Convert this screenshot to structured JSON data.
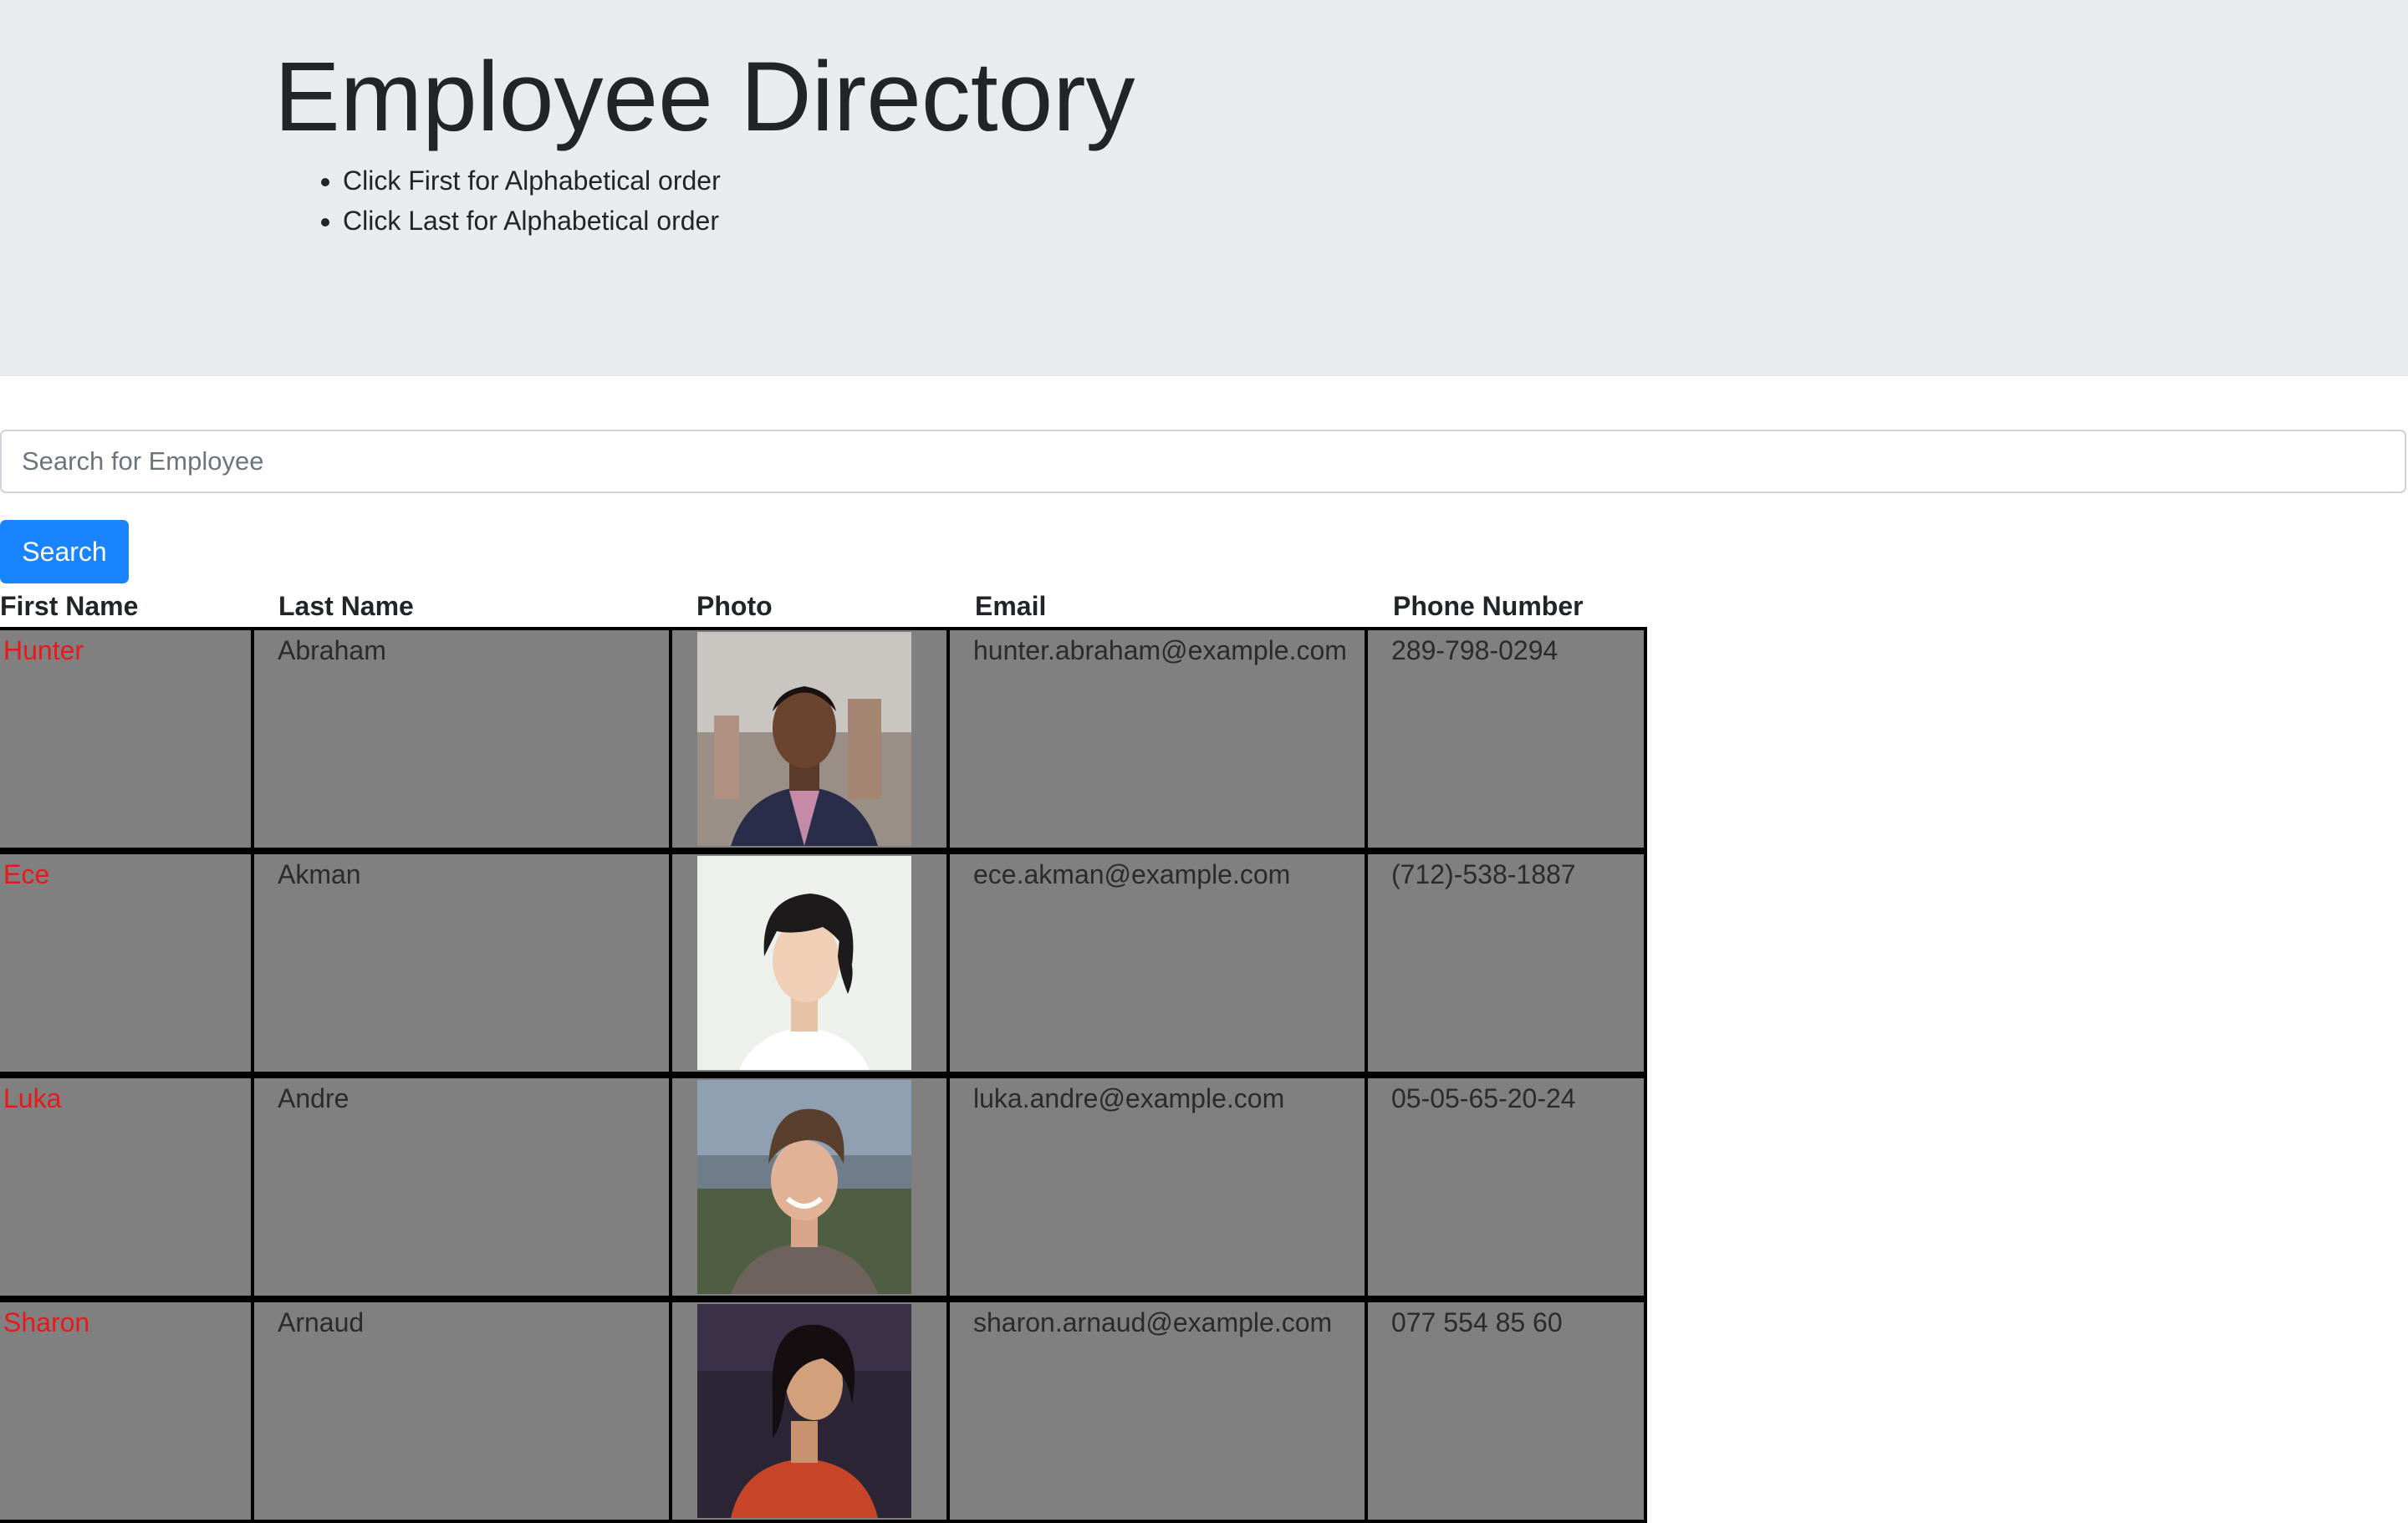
{
  "header": {
    "title": "Employee Directory",
    "hints": [
      "Click First for Alphabetical order",
      "Click Last for Alphabetical order"
    ]
  },
  "search": {
    "placeholder": "Search for Employee",
    "value": "",
    "button_label": "Search",
    "button_color": "#1a84ff"
  },
  "table": {
    "columns": [
      "First Name",
      "Last Name",
      "Photo",
      "Email",
      "Phone Number"
    ],
    "rows": [
      {
        "first": "Hunter",
        "last": "Abraham",
        "email": "hunter.abraham@example.com",
        "phone": "289-798-0294",
        "photo": "man-in-suit-portrait"
      },
      {
        "first": "Ece",
        "last": "Akman",
        "email": "ece.akman@example.com",
        "phone": "(712)-538-1887",
        "photo": "woman-short-hair-portrait"
      },
      {
        "first": "Luka",
        "last": "Andre",
        "email": "luka.andre@example.com",
        "phone": "05-05-65-20-24",
        "photo": "smiling-young-man-portrait"
      },
      {
        "first": "Sharon",
        "last": "Arnaud",
        "email": "sharon.arnaud@example.com",
        "phone": "077 554 85 60",
        "photo": "woman-red-top-portrait"
      }
    ]
  },
  "colors": {
    "jumbotron_bg": "#e9ecef",
    "row_bg": "#808080",
    "first_name": "#e8191b",
    "border": "#000000"
  }
}
